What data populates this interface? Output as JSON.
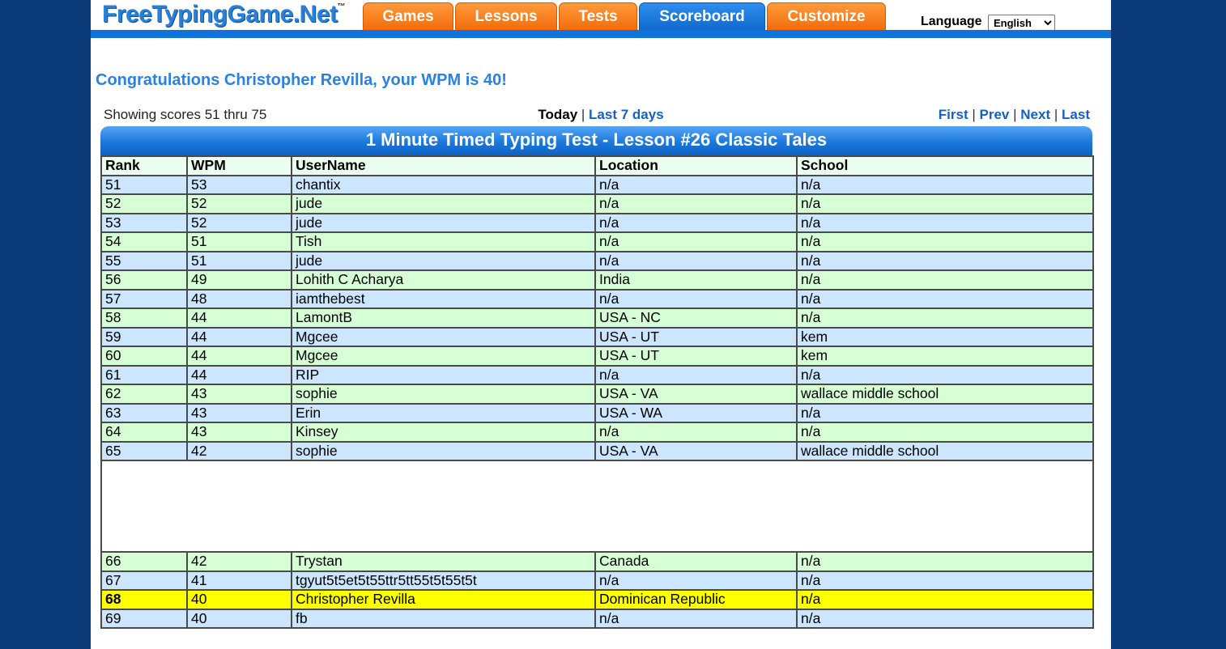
{
  "header": {
    "logo_text": "FreeTypingGame.Net",
    "logo_tm": "™",
    "tabs": [
      "Games",
      "Lessons",
      "Tests",
      "Scoreboard",
      "Customize"
    ],
    "active_tab": "Scoreboard",
    "language_label": "Language",
    "language_value": "English"
  },
  "congrats": "Congratulations Christopher Revilla, your WPM is 40!",
  "nav": {
    "showing": "Showing scores 51 thru 75",
    "today": "Today",
    "last7": "Last 7 days",
    "first": "First",
    "prev": "Prev",
    "next": "Next",
    "last": "Last",
    "sep": "|"
  },
  "table": {
    "title": "1 Minute Timed Typing Test - Lesson #26 Classic Tales",
    "headers": [
      "Rank",
      "WPM",
      "UserName",
      "Location",
      "School"
    ],
    "rows": [
      [
        "51",
        "53",
        "chantix",
        "n/a",
        "n/a"
      ],
      [
        "52",
        "52",
        "jude",
        "n/a",
        "n/a"
      ],
      [
        "53",
        "52",
        "jude",
        "n/a",
        "n/a"
      ],
      [
        "54",
        "51",
        "Tish",
        "n/a",
        "n/a"
      ],
      [
        "55",
        "51",
        "jude",
        "n/a",
        "n/a"
      ],
      [
        "56",
        "49",
        "Lohith C Acharya",
        "India",
        "n/a"
      ],
      [
        "57",
        "48",
        "iamthebest",
        "n/a",
        "n/a"
      ],
      [
        "58",
        "44",
        "LamontB",
        "USA - NC",
        "n/a"
      ],
      [
        "59",
        "44",
        "Mgcee",
        "USA - UT",
        "kem"
      ],
      [
        "60",
        "44",
        "Mgcee",
        "USA - UT",
        "kem"
      ],
      [
        "61",
        "44",
        "RIP",
        "n/a",
        "n/a"
      ],
      [
        "62",
        "43",
        "sophie",
        "USA - VA",
        "wallace middle school"
      ],
      [
        "63",
        "43",
        "Erin",
        "USA - WA",
        "n/a"
      ],
      [
        "64",
        "43",
        "Kinsey",
        "n/a",
        "n/a"
      ],
      [
        "65",
        "42",
        "sophie",
        "USA - VA",
        "wallace middle school"
      ],
      [
        "66",
        "42",
        "Trystan",
        "Canada",
        "n/a"
      ],
      [
        "67",
        "41",
        "tgyut5t5et5t55ttr5tt55t5t55t5t",
        "n/a",
        "n/a"
      ],
      [
        "68",
        "40",
        "Christopher Revilla",
        "Dominican Republic",
        "n/a"
      ],
      [
        "69",
        "40",
        "fb",
        "n/a",
        "n/a"
      ]
    ],
    "highlight_rank": "68",
    "gap_after_rank": "65"
  },
  "colors": {
    "page_bg": "#0a3a78",
    "tab_orange": "#f26b0a",
    "tab_active_blue": "#1068cc",
    "row_blue": "#cce6ff",
    "row_green": "#d6ffd6",
    "row_highlight": "#ffff00"
  }
}
